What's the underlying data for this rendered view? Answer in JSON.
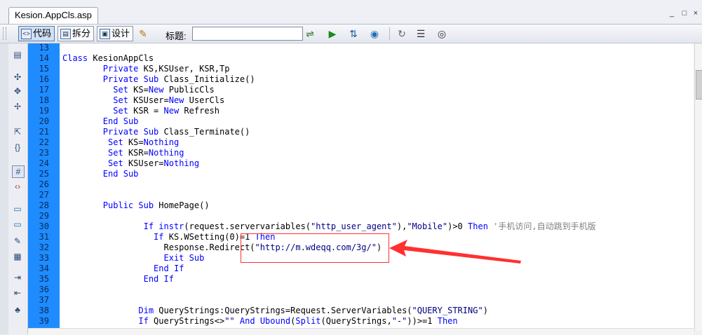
{
  "tab": {
    "title": "Kesion.AppCls.asp"
  },
  "window_controls": {
    "minimize": "_",
    "maximize": "□",
    "close": "×"
  },
  "toolbar": {
    "code_label": "代码",
    "split_label": "拆分",
    "design_label": "设计",
    "title_label": "标题:",
    "title_value": ""
  },
  "editor": {
    "lines": [
      {
        "num": "13",
        "code": ""
      },
      {
        "num": "14",
        "code": "Class KesionAppCls"
      },
      {
        "num": "15",
        "code": "        Private KS,KSUser, KSR,Tp"
      },
      {
        "num": "16",
        "code": "        Private Sub Class_Initialize()"
      },
      {
        "num": "17",
        "code": "          Set KS=New PublicCls"
      },
      {
        "num": "18",
        "code": "          Set KSUser=New UserCls"
      },
      {
        "num": "19",
        "code": "          Set KSR = New Refresh"
      },
      {
        "num": "20",
        "code": "        End Sub"
      },
      {
        "num": "21",
        "code": "        Private Sub Class_Terminate()"
      },
      {
        "num": "22",
        "code": "         Set KS=Nothing"
      },
      {
        "num": "23",
        "code": "         Set KSR=Nothing"
      },
      {
        "num": "24",
        "code": "         Set KSUser=Nothing"
      },
      {
        "num": "25",
        "code": "        End Sub"
      },
      {
        "num": "26",
        "code": ""
      },
      {
        "num": "27",
        "code": ""
      },
      {
        "num": "28",
        "code": "        Public Sub HomePage()"
      },
      {
        "num": "29",
        "code": ""
      },
      {
        "num": "30",
        "code": "                If instr(request.servervariables(\"http_user_agent\"),\"Mobile\")>0 Then '手机访问,自动跳到手机版"
      },
      {
        "num": "31",
        "code": "                  If KS.WSetting(0)=1 Then"
      },
      {
        "num": "32",
        "code": "                    Response.Redirect(\"http://m.wdeqq.com/3g/\")"
      },
      {
        "num": "33",
        "code": "                    Exit Sub"
      },
      {
        "num": "34",
        "code": "                  End If"
      },
      {
        "num": "35",
        "code": "                End If"
      },
      {
        "num": "36",
        "code": ""
      },
      {
        "num": "37",
        "code": ""
      },
      {
        "num": "38",
        "code": "               Dim QueryStrings:QueryStrings=Request.ServerVariables(\"QUERY_STRING\")"
      },
      {
        "num": "39",
        "code": "               If QueryStrings<>\"\" And Ubound(Split(QueryStrings,\"-\"))>=1 Then"
      }
    ]
  },
  "colors": {
    "line_number_bg": "#1e8cff",
    "keyword": "#0000ff",
    "annotation": "#ff3030"
  }
}
